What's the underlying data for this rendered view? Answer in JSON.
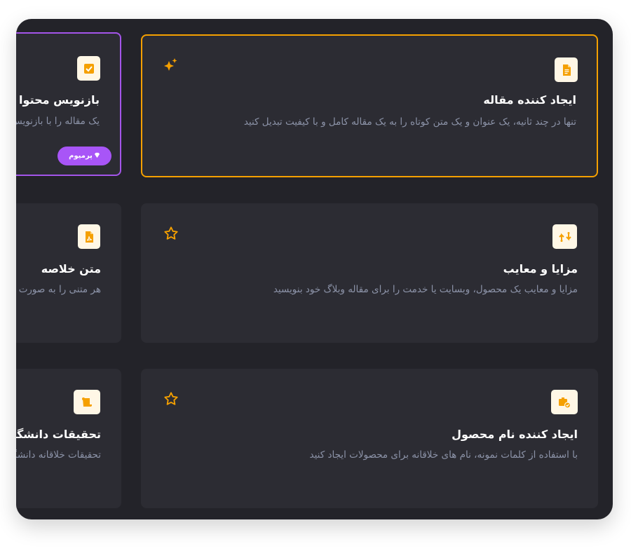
{
  "colors": {
    "background": "#232329",
    "card": "#2c2c33",
    "accent": "#f5a000",
    "premium": "#a855f7",
    "title": "#ffffff",
    "description": "#8c93a8"
  },
  "cards": [
    {
      "title": "ایجاد کننده مقاله",
      "description": "تنها در چند ثانیه، یک عنوان و یک متن کوتاه را به یک مقاله کامل و با کیفیت تبدیل کنید",
      "icon": "document-icon",
      "favorite_icon": "sparkle-stars-icon",
      "selected": true
    },
    {
      "title": "بازنویس محتوا",
      "description": "یک مقاله را با بازنویس",
      "icon": "checkbox-icon",
      "badge": "پرمیوم",
      "badge_icon": "diamond-icon"
    },
    {
      "title": "مزایا و معایب",
      "description": "مزایا و معایب یک محصول، وبسایت یا خدمت را برای مقاله وبلاگ خود بنویسید",
      "icon": "swap-arrows-icon",
      "favorite_icon": "star-outline-icon"
    },
    {
      "title": "متن خلاصه",
      "description": "هر متنی را به صورت",
      "icon": "pdf-file-icon"
    },
    {
      "title": "ایجاد کننده نام محصول",
      "description": "با استفاده از کلمات نمونه، نام های خلاقانه برای محصولات ایجاد کنید",
      "icon": "product-box-icon",
      "favorite_icon": "star-outline-icon"
    },
    {
      "title": "تحقیقات دانشگاهی",
      "description": "تحقیقات خلاقانه دانشگاهی",
      "icon": "scroll-icon"
    }
  ]
}
